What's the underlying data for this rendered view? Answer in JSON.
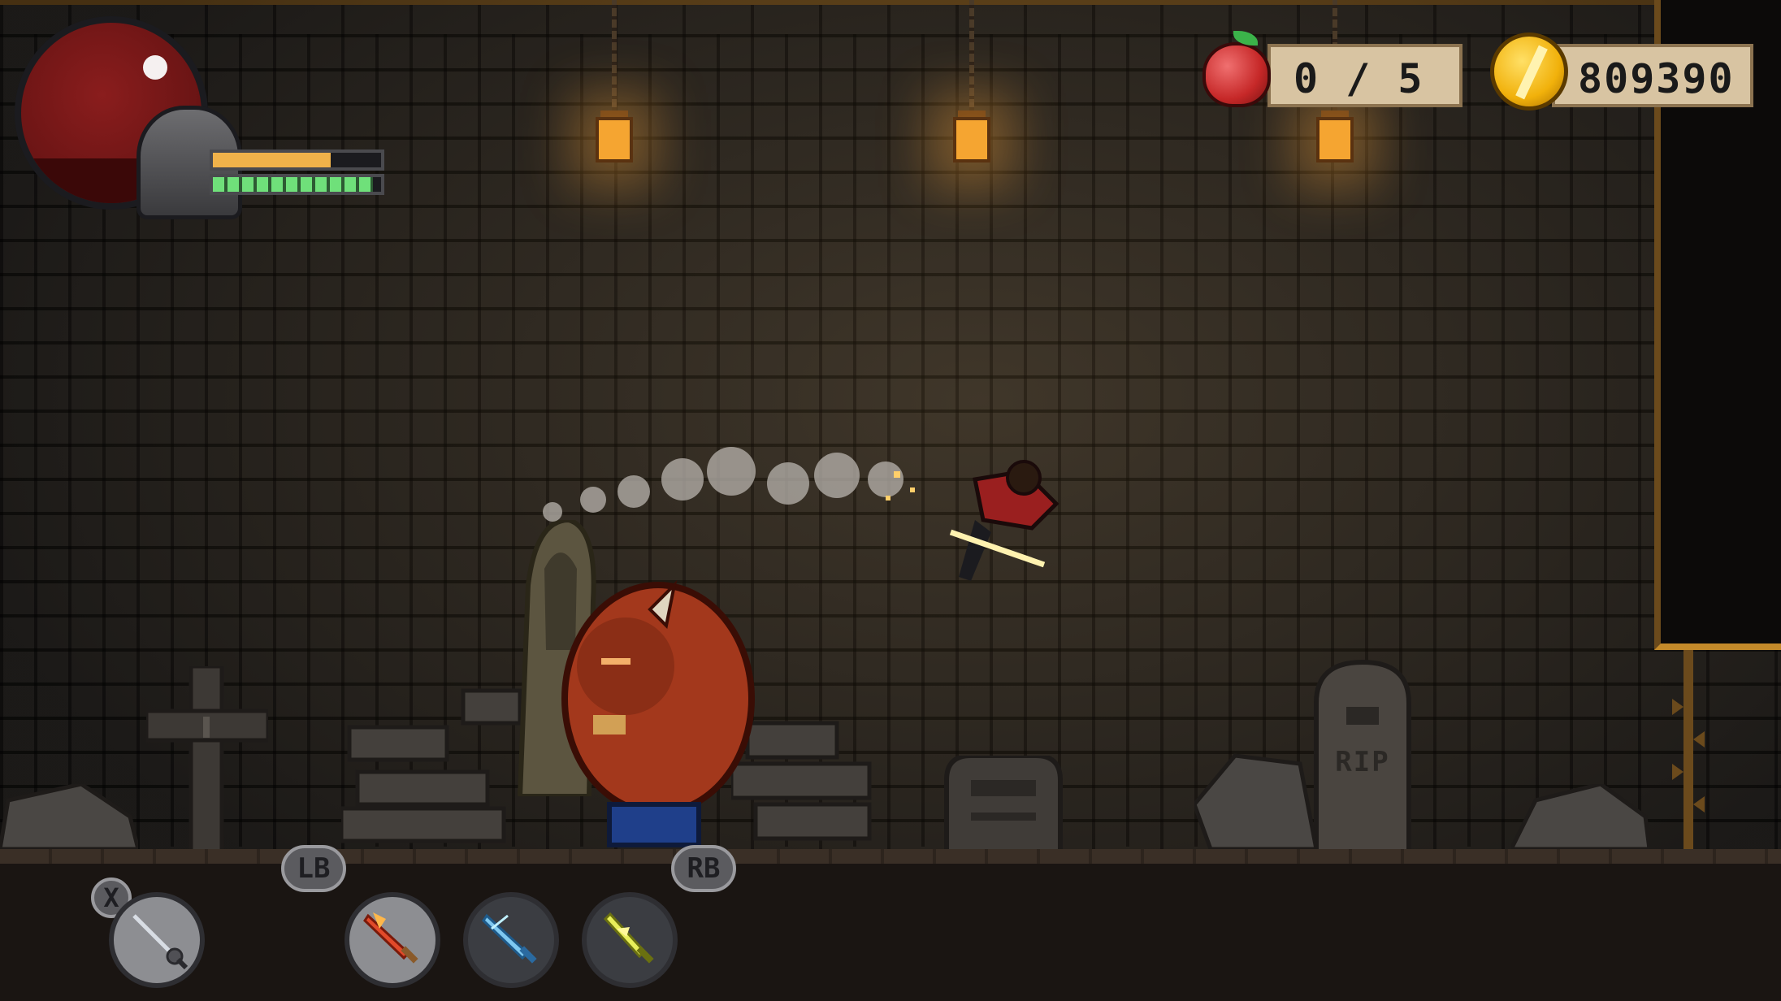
{
  "hud": {
    "health_fraction": 0.25,
    "stamina_fraction": 0.7,
    "energy_fraction": 0.95,
    "apples": {
      "collected": "0",
      "separator": "/",
      "total": "5",
      "text": "0 / 5"
    },
    "coins": {
      "text": "809390"
    }
  },
  "controls": {
    "swap_button": "X",
    "left_bumper": "LB",
    "right_bumper": "RB",
    "weapon_slots": [
      {
        "icon": "rapier-icon",
        "selected": true
      },
      {
        "icon": "flame-sword-icon",
        "selected": false
      },
      {
        "icon": "ice-sword-icon",
        "selected": false
      },
      {
        "icon": "electric-blade-icon",
        "selected": false
      }
    ]
  },
  "scene": {
    "tombstone_text": "RIP"
  },
  "colors": {
    "health": "#8a1d1d",
    "stamina": "#f0b24a",
    "energy": "#6fe07a",
    "gold": "#f1b10b",
    "lantern": "#f5a531"
  }
}
